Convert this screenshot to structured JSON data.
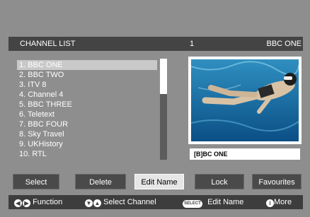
{
  "header": {
    "title": "CHANNEL LIST",
    "number": "1",
    "channel": "BBC ONE"
  },
  "channels": [
    "1. BBC ONE",
    "2. BBC TWO",
    "3. ITV 8",
    "4. Channel 4",
    "5. BBC THREE",
    "6. Teletext",
    "7. BBC FOUR",
    "8. Sky Travel",
    "9. UKHistory",
    "10. RTL"
  ],
  "selected_channel": "1. BBC ONE",
  "preview": {
    "label": "[B]BC ONE"
  },
  "buttons": {
    "select": "Select",
    "delete": "Delete",
    "edit_name": "Edit Name",
    "lock": "Lock",
    "favourites": "Favourites"
  },
  "footer": {
    "function": "Function",
    "select_channel": "Select Channel",
    "select_key": "SELECT",
    "edit_name": "Edit Name",
    "more": "More",
    "info_key": "i"
  },
  "colors": {
    "background": "#8e8e8e",
    "header": "#444444",
    "footer": "#3d3d3d",
    "highlight": "#c9c9c9",
    "dark_button": "#4a4a4a",
    "light_button": "#e6e6e6"
  }
}
